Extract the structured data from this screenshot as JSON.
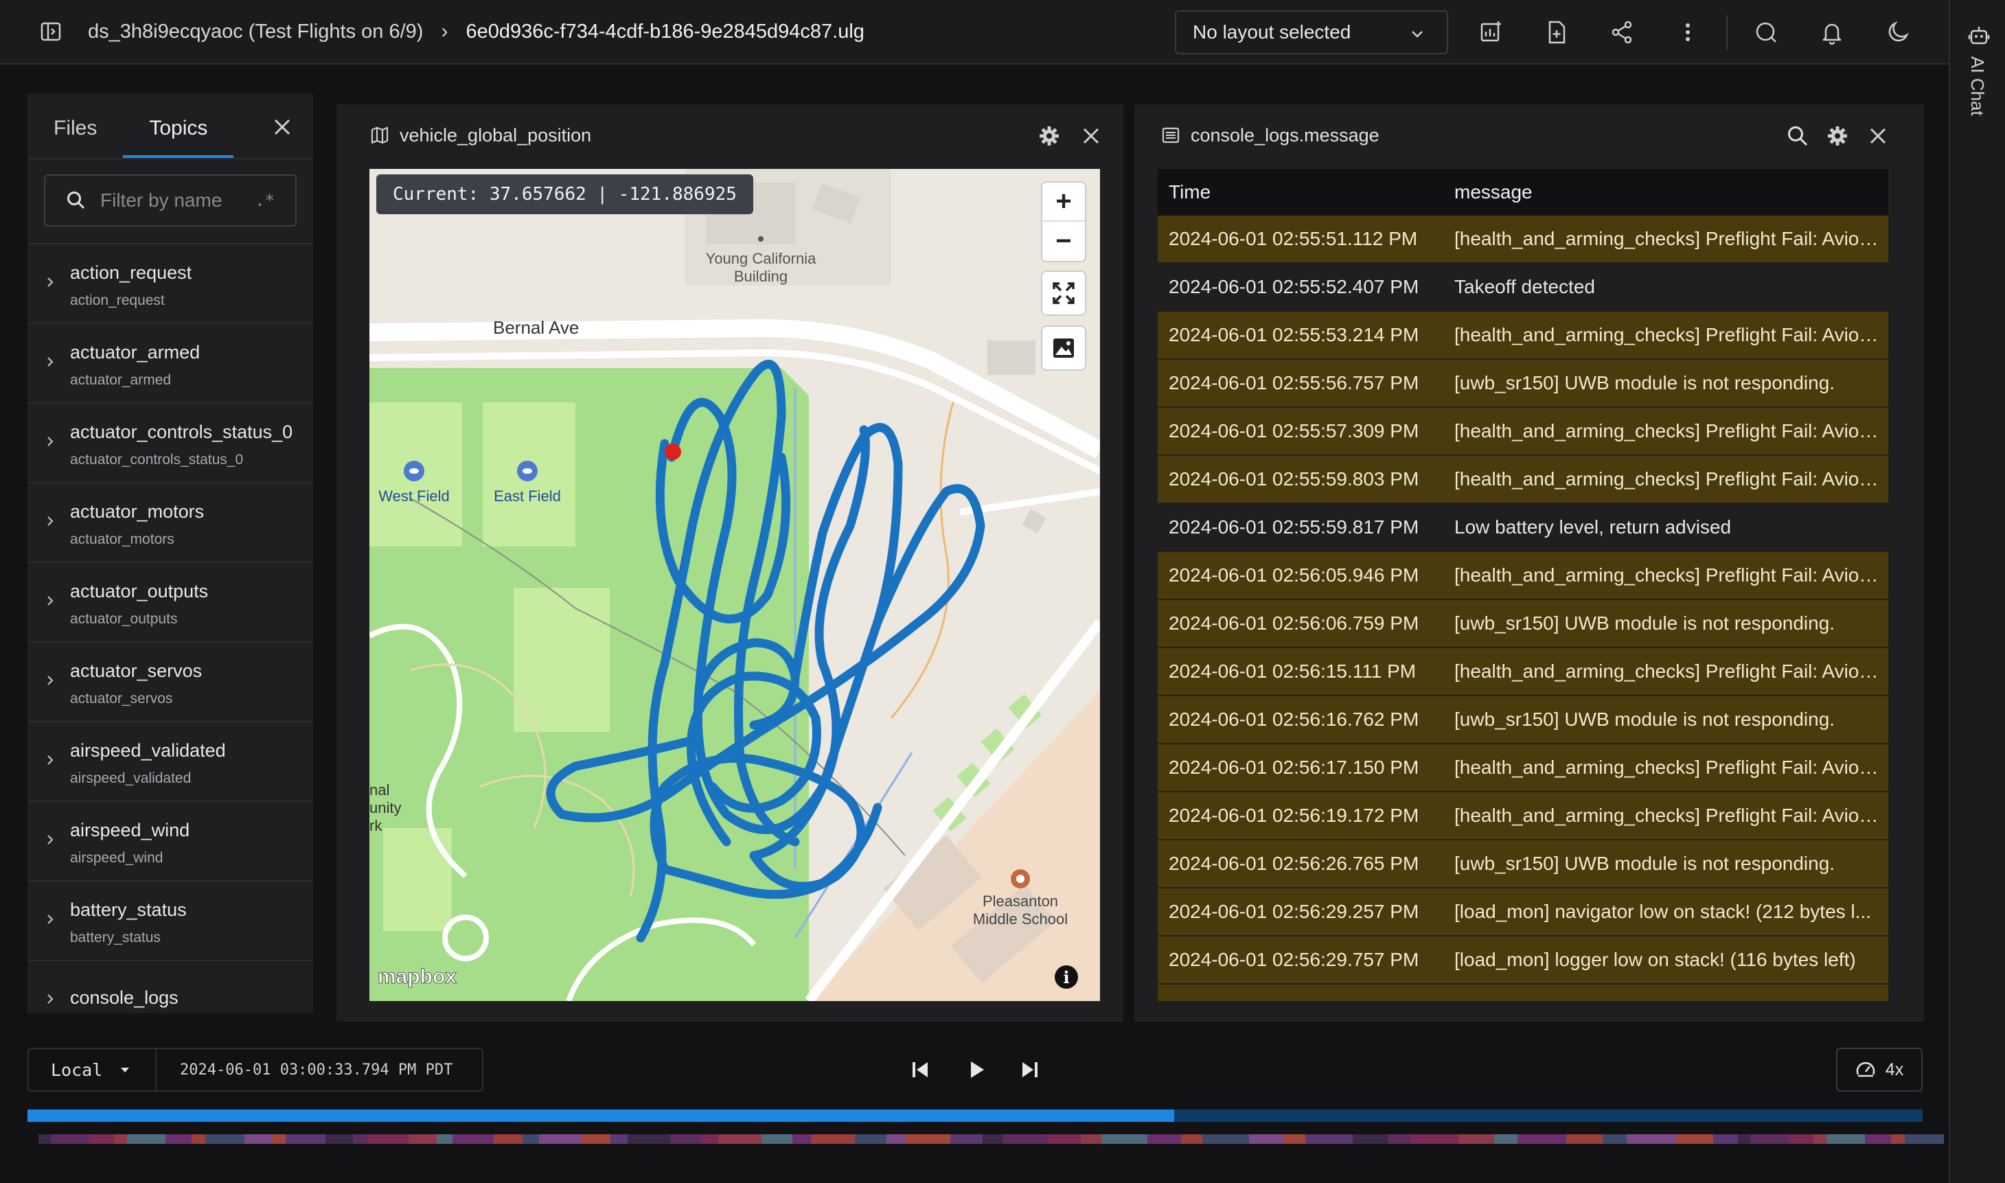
{
  "header": {
    "dataset": "ds_3h8i9ecqyaoc (Test Flights on 6/9)",
    "file": "6e0d936c-f734-4cdf-b186-9e2845d94c87.ulg",
    "layout_select": "No layout selected"
  },
  "ai_chat": {
    "label": "AI Chat"
  },
  "sidebar": {
    "tabs": [
      "Files",
      "Topics"
    ],
    "active_tab": "Topics",
    "filter_placeholder": "Filter by name",
    "regex_toggle": ".*",
    "topics": [
      {
        "name": "action_request",
        "sub": "action_request"
      },
      {
        "name": "actuator_armed",
        "sub": "actuator_armed"
      },
      {
        "name": "actuator_controls_status_0",
        "sub": "actuator_controls_status_0"
      },
      {
        "name": "actuator_motors",
        "sub": "actuator_motors"
      },
      {
        "name": "actuator_outputs",
        "sub": "actuator_outputs"
      },
      {
        "name": "actuator_servos",
        "sub": "actuator_servos"
      },
      {
        "name": "airspeed_validated",
        "sub": "airspeed_validated"
      },
      {
        "name": "airspeed_wind",
        "sub": "airspeed_wind"
      },
      {
        "name": "battery_status",
        "sub": "battery_status"
      },
      {
        "name": "console_logs",
        "sub": ""
      }
    ]
  },
  "map_panel": {
    "title": "vehicle_global_position",
    "coordinate_readout": "Current: 37.657662 | -121.886925",
    "labels": {
      "street": "Bernal Ave",
      "building": "Young California",
      "building2": "Building",
      "west_field": "West Field",
      "east_field": "East Field",
      "school": "Pleasanton",
      "school2": "Middle School",
      "park1": "nal",
      "park2": "unity",
      "park3": "rk"
    },
    "attribution": "mapbox",
    "track_color": "#1a73c0",
    "marker_color": "#e0201b"
  },
  "log_panel": {
    "title": "console_logs.message",
    "columns": [
      "Time",
      "message"
    ],
    "rows": [
      {
        "time": "2024-06-01 02:55:51.112 PM",
        "message": "[health_and_arming_checks] Preflight Fail: Avion...",
        "level": "warn"
      },
      {
        "time": "2024-06-01 02:55:52.407 PM",
        "message": "Takeoff detected",
        "level": "info"
      },
      {
        "time": "2024-06-01 02:55:53.214 PM",
        "message": "[health_and_arming_checks] Preflight Fail: Avion...",
        "level": "warn"
      },
      {
        "time": "2024-06-01 02:55:56.757 PM",
        "message": "[uwb_sr150] UWB module is not responding.",
        "level": "warn"
      },
      {
        "time": "2024-06-01 02:55:57.309 PM",
        "message": "[health_and_arming_checks] Preflight Fail: Avion...",
        "level": "warn"
      },
      {
        "time": "2024-06-01 02:55:59.803 PM",
        "message": "[health_and_arming_checks] Preflight Fail: Avion...",
        "level": "warn"
      },
      {
        "time": "2024-06-01 02:55:59.817 PM",
        "message": "Low battery level, return advised",
        "level": "info"
      },
      {
        "time": "2024-06-01 02:56:05.946 PM",
        "message": "[health_and_arming_checks] Preflight Fail: Avion...",
        "level": "warn"
      },
      {
        "time": "2024-06-01 02:56:06.759 PM",
        "message": "[uwb_sr150] UWB module is not responding.",
        "level": "warn"
      },
      {
        "time": "2024-06-01 02:56:15.111 PM",
        "message": "[health_and_arming_checks] Preflight Fail: Avion...",
        "level": "warn"
      },
      {
        "time": "2024-06-01 02:56:16.762 PM",
        "message": "[uwb_sr150] UWB module is not responding.",
        "level": "warn"
      },
      {
        "time": "2024-06-01 02:56:17.150 PM",
        "message": "[health_and_arming_checks] Preflight Fail: Avion...",
        "level": "warn"
      },
      {
        "time": "2024-06-01 02:56:19.172 PM",
        "message": "[health_and_arming_checks] Preflight Fail: Avion...",
        "level": "warn"
      },
      {
        "time": "2024-06-01 02:56:26.765 PM",
        "message": "[uwb_sr150] UWB module is not responding.",
        "level": "warn"
      },
      {
        "time": "2024-06-01 02:56:29.257 PM",
        "message": "[load_mon] navigator low on stack! (212 bytes l...",
        "level": "warn"
      },
      {
        "time": "2024-06-01 02:56:29.757 PM",
        "message": "[load_mon] logger low on stack! (116 bytes left)",
        "level": "warn"
      }
    ]
  },
  "playback": {
    "timezone": "Local",
    "timestamp": "2024-06-01 03:00:33.794 PM PDT",
    "speed": "4x",
    "progress": 0.605
  },
  "colors": {
    "accent": "#1e88e5",
    "warn_row": "#4a3b0c",
    "panel": "#1f1f22",
    "background": "#121214"
  }
}
